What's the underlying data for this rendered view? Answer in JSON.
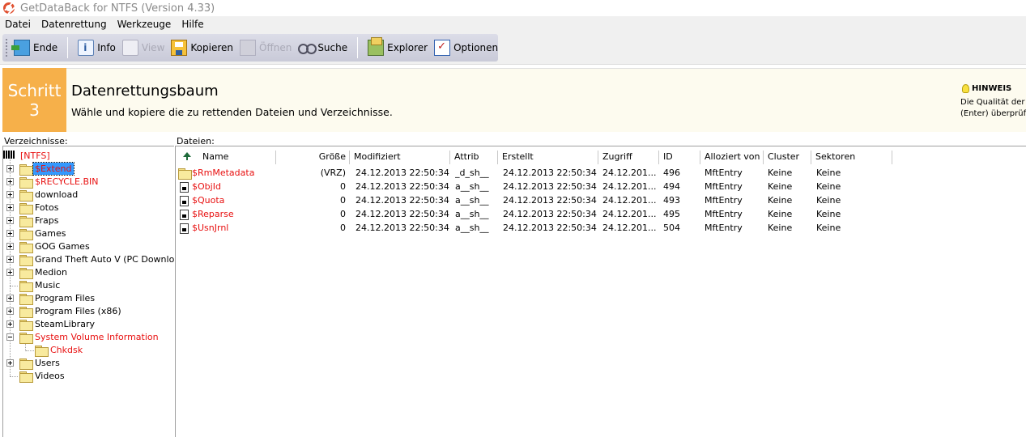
{
  "window": {
    "title": "GetDataBack for NTFS (Version 4.33)"
  },
  "menu": [
    "Datei",
    "Datenrettung",
    "Werkzeuge",
    "Hilfe"
  ],
  "toolbar": {
    "ende": "Ende",
    "info": "Info",
    "view": "View",
    "kopieren": "Kopieren",
    "oeffnen": "Öffnen",
    "suche": "Suche",
    "explorer": "Explorer",
    "optionen": "Optionen"
  },
  "step": {
    "label": "Schritt",
    "number": "3",
    "title": "Datenrettungsbaum",
    "subtitle": "Wähle und kopiere die zu rettenden Dateien und Verzeichnisse.",
    "hint_title": "HINWEIS",
    "hint_line1": "Die Qualität der g",
    "hint_line2": "(Enter) überprüft"
  },
  "tree": {
    "label": "Verzeichnisse:",
    "root": "[NTFS]",
    "items": [
      {
        "label": "$Extend"
      },
      {
        "label": "$RECYCLE.BIN"
      },
      {
        "label": "download"
      },
      {
        "label": "Fotos"
      },
      {
        "label": "Fraps"
      },
      {
        "label": "Games"
      },
      {
        "label": "GOG Games"
      },
      {
        "label": "Grand Theft Auto V (PC Download)"
      },
      {
        "label": "Medion"
      },
      {
        "label": "Music"
      },
      {
        "label": "Program Files"
      },
      {
        "label": "Program Files (x86)"
      },
      {
        "label": "SteamLibrary"
      },
      {
        "label": "System Volume Information"
      },
      {
        "label": "Chkdsk"
      },
      {
        "label": "Users"
      },
      {
        "label": "Videos"
      }
    ]
  },
  "files": {
    "label": "Dateien:",
    "columns": [
      "Name",
      "Größe",
      "Modifiziert",
      "Attrib",
      "Erstellt",
      "Zugriff",
      "ID",
      "Alloziert von",
      "Cluster",
      "Sektoren"
    ],
    "rows": [
      {
        "name": "$RmMetadata",
        "size": "(VRZ)",
        "modified": "24.12.2013 22:50:34",
        "attrib": "_d_sh__",
        "created": "24.12.2013 22:50:34",
        "access": "24.12.201...",
        "id": "496",
        "alloc": "MftEntry",
        "cluster": "Keine",
        "sectors": "Keine"
      },
      {
        "name": "$ObjId",
        "size": "0",
        "modified": "24.12.2013 22:50:34",
        "attrib": "a__sh__",
        "created": "24.12.2013 22:50:34",
        "access": "24.12.201...",
        "id": "494",
        "alloc": "MftEntry",
        "cluster": "Keine",
        "sectors": "Keine"
      },
      {
        "name": "$Quota",
        "size": "0",
        "modified": "24.12.2013 22:50:34",
        "attrib": "a__sh__",
        "created": "24.12.2013 22:50:34",
        "access": "24.12.201...",
        "id": "493",
        "alloc": "MftEntry",
        "cluster": "Keine",
        "sectors": "Keine"
      },
      {
        "name": "$Reparse",
        "size": "0",
        "modified": "24.12.2013 22:50:34",
        "attrib": "a__sh__",
        "created": "24.12.2013 22:50:34",
        "access": "24.12.201...",
        "id": "495",
        "alloc": "MftEntry",
        "cluster": "Keine",
        "sectors": "Keine"
      },
      {
        "name": "$UsnJrnl",
        "size": "0",
        "modified": "24.12.2013 22:50:34",
        "attrib": "a__sh__",
        "created": "24.12.2013 22:50:34",
        "access": "24.12.201...",
        "id": "504",
        "alloc": "MftEntry",
        "cluster": "Keine",
        "sectors": "Keine"
      }
    ]
  }
}
